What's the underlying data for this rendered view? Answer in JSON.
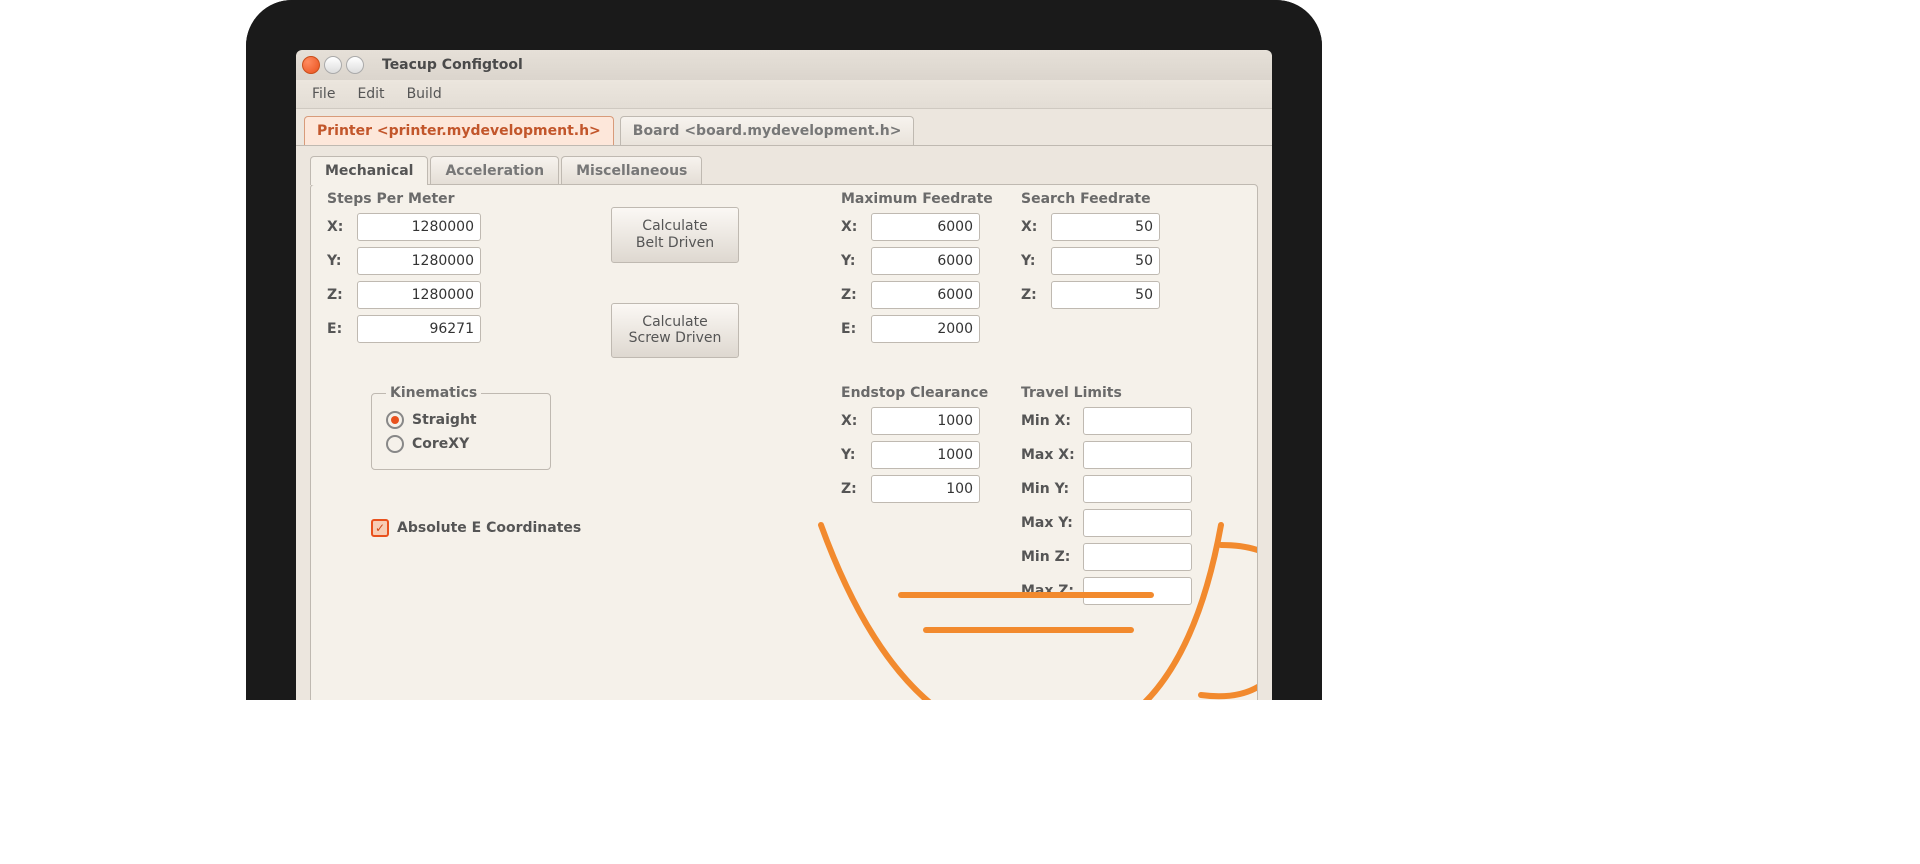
{
  "window": {
    "title": "Teacup Configtool"
  },
  "menubar": {
    "file": "File",
    "edit": "Edit",
    "build": "Build"
  },
  "main_tabs": {
    "printer": "Printer <printer.mydevelopment.h>",
    "board": "Board <board.mydevelopment.h>"
  },
  "sub_tabs": {
    "mechanical": "Mechanical",
    "acceleration": "Acceleration",
    "misc": "Miscellaneous"
  },
  "groups": {
    "steps_title": "Steps Per Meter",
    "maxfr_title": "Maximum Feedrate",
    "srchfr_title": "Search Feedrate",
    "endcl_title": "Endstop Clearance",
    "travel_title": "Travel Limits",
    "kinematics": "Kinematics"
  },
  "axis_labels": {
    "x": "X:",
    "y": "Y:",
    "z": "Z:",
    "e": "E:"
  },
  "travel_labels": {
    "minx": "Min X:",
    "maxx": "Max X:",
    "miny": "Min Y:",
    "maxy": "Max Y:",
    "minz": "Min Z:",
    "maxz": "Max Z:"
  },
  "buttons": {
    "calc_belt": "Calculate\nBelt Driven",
    "calc_screw": "Calculate\nScrew Driven"
  },
  "kine_options": {
    "straight": "Straight",
    "corexy": "CoreXY"
  },
  "checkbox": {
    "abs_e": "Absolute E Coordinates"
  },
  "values": {
    "steps": {
      "x": "1280000",
      "y": "1280000",
      "z": "1280000",
      "e": "96271"
    },
    "maxfr": {
      "x": "6000",
      "y": "6000",
      "z": "6000",
      "e": "2000"
    },
    "srchfr": {
      "x": "50",
      "y": "50",
      "z": "50"
    },
    "endcl": {
      "x": "1000",
      "y": "1000",
      "z": "100"
    },
    "travel": {
      "minx": "",
      "maxx": "",
      "miny": "",
      "maxy": "",
      "minz": "",
      "maxz": ""
    }
  },
  "state": {
    "kinematics": "straight",
    "abs_e": true
  }
}
